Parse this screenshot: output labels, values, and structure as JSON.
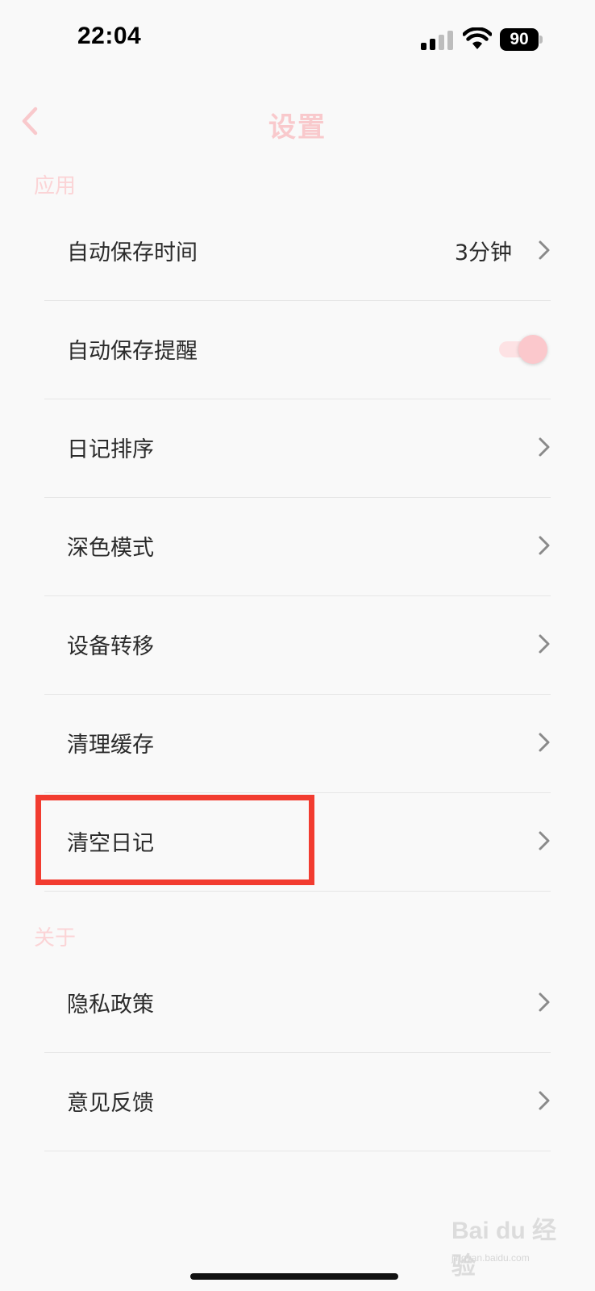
{
  "status_bar": {
    "time": "22:04",
    "battery": "90",
    "icons": [
      "signal-icon",
      "wifi-icon",
      "battery-icon"
    ]
  },
  "nav": {
    "title": "设置",
    "back_icon": "chevron-left-icon",
    "accent_color": "#f9c9cc"
  },
  "sections": {
    "app": {
      "header": "应用",
      "items": [
        {
          "label": "自动保存时间",
          "value": "3分钟"
        },
        {
          "label": "自动保存提醒",
          "toggle": true
        },
        {
          "label": "日记排序"
        },
        {
          "label": "深色模式"
        },
        {
          "label": "设备转移"
        },
        {
          "label": "清理缓存"
        },
        {
          "label": "清空日记"
        }
      ]
    },
    "about": {
      "header": "关于",
      "items": [
        {
          "label": "隐私政策"
        },
        {
          "label": "意见反馈"
        }
      ]
    }
  },
  "annotation": {
    "highlight_color": "#f23c30",
    "highlighted_item": "清空日记"
  },
  "watermark": {
    "text": "Bai du 经验",
    "sub": "jingyan.baidu.com"
  }
}
